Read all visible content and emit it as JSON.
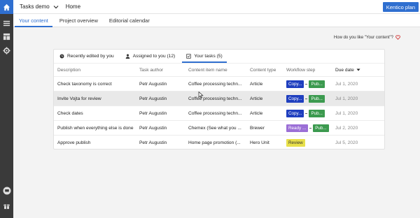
{
  "topbar": {
    "project": "Tasks demo",
    "breadcrumb": "Home",
    "plan_button": "Kentico plan"
  },
  "nav_tabs": [
    {
      "label": "Your content",
      "active": true
    },
    {
      "label": "Project overview",
      "active": false
    },
    {
      "label": "Editorial calendar",
      "active": false
    }
  ],
  "feedback": {
    "text": "How do you like \"Your content\"?"
  },
  "filters": [
    {
      "label": "Recently edited by you",
      "icon": "clock-icon",
      "active": false
    },
    {
      "label": "Assigned to you (12)",
      "icon": "user-icon",
      "active": false
    },
    {
      "label": "Your tasks (5)",
      "icon": "checkbox-icon",
      "active": true
    }
  ],
  "table": {
    "headers": [
      "Description",
      "Task author",
      "Content item name",
      "Content type",
      "Workflow step",
      "Due date"
    ],
    "rows": [
      {
        "description": "Check taxonomy is correct",
        "author": "Petr Augustin",
        "item": "Coffee processing techn...",
        "type": "Article",
        "steps": [
          {
            "label": "Copy...",
            "color": "#1f3fbf"
          },
          {
            "label": "Pub...",
            "color": "#3c9a4f"
          }
        ],
        "due": "Jul 1, 2020"
      },
      {
        "description": "Invite Vojta for review",
        "author": "Petr Augustin",
        "item": "Coffee processing techn...",
        "type": "Article",
        "steps": [
          {
            "label": "Copy...",
            "color": "#1f3fbf"
          },
          {
            "label": "Pub...",
            "color": "#3c9a4f"
          }
        ],
        "due": "Jul 1, 2020"
      },
      {
        "description": "Check dates",
        "author": "Petr Augustin",
        "item": "Coffee processing techn...",
        "type": "Article",
        "steps": [
          {
            "label": "Copy...",
            "color": "#1f3fbf"
          },
          {
            "label": "Pub...",
            "color": "#3c9a4f"
          }
        ],
        "due": "Jul 1, 2020"
      },
      {
        "description": "Publish when everything else is done",
        "author": "Petr Augustin",
        "item": "Chemex (See what you ...",
        "type": "Brewer",
        "steps": [
          {
            "label": "Ready ...",
            "color": "#9b6fd6"
          },
          {
            "label": "Pub...",
            "color": "#3c9a4f"
          }
        ],
        "due": "Jul 2, 2020"
      },
      {
        "description": "Approve publish",
        "author": "Petr Augustin",
        "item": "Home page promotion (...",
        "type": "Hero Unit",
        "steps": [
          {
            "label": "Review",
            "color": "#e8e04a",
            "text": "#333"
          }
        ],
        "due": "Jul 5, 2020"
      }
    ]
  },
  "colors": {
    "accent": "#2f6fd0",
    "rail": "#3a3a3a"
  }
}
